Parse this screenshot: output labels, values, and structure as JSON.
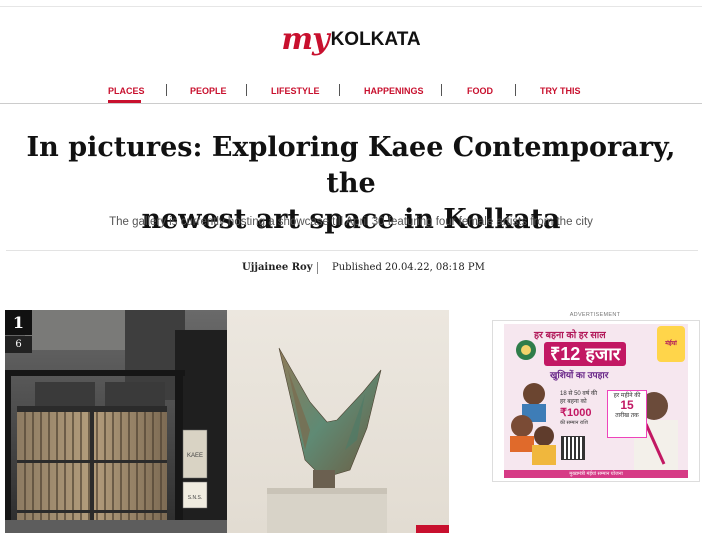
{
  "site": {
    "logo_my": "my",
    "logo_city": "KOLKATA"
  },
  "nav": {
    "items": [
      "PLACES",
      "PEOPLE",
      "LIFESTYLE",
      "HAPPENINGS",
      "FOOD",
      "TRY THIS"
    ],
    "active": "PLACES"
  },
  "article": {
    "headline_line1": "In pictures: Exploring Kaee Contemporary, the",
    "headline_line2": "newest art space in Kolkata",
    "standfirst": "The gallery is currently hosting a showcase till April 30 featuring four female artists from the city",
    "author": "Ujjainee Roy",
    "published": "Published 20.04.22, 08:18 PM"
  },
  "gallery": {
    "current": "1",
    "total": "6",
    "sign_text": "KAEE",
    "nameplate_text": "S.N.S."
  },
  "ad": {
    "label": "ADVERTISEMENT",
    "headline_top": "हर बहना को हर साल",
    "headline_amount": "₹12 हजार",
    "headline_sub": "खुशियों का उपहार",
    "brand": "मंईयां",
    "line1": "18 से 50 वर्ष की हर बहना को",
    "amount": "₹1000",
    "line2": "की सम्मान राशि",
    "date_top": "हर महीने की",
    "date_num": "15",
    "date_bottom": "तारीख तक",
    "footer": "मुख्यमंत्री मंईयां सम्मान योजना"
  },
  "colors": {
    "brand_red": "#c8102e",
    "ad_pink": "#c21863"
  }
}
